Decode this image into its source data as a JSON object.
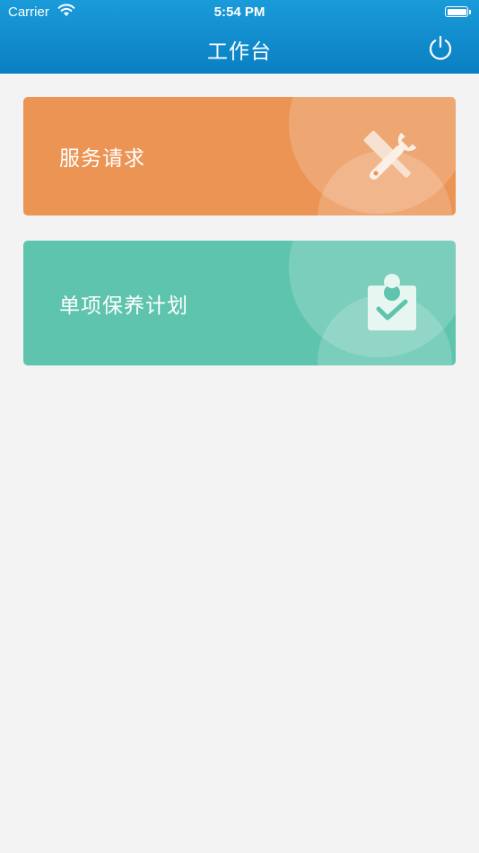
{
  "status_bar": {
    "carrier": "Carrier",
    "time": "5:54 PM"
  },
  "nav": {
    "title": "工作台",
    "power_icon": "power-icon"
  },
  "cards": [
    {
      "label": "服务请求",
      "icon": "tools-icon",
      "color": "#eb9454"
    },
    {
      "label": "单项保养计划",
      "icon": "clipboard-check-icon",
      "color": "#5ec4ad"
    }
  ],
  "colors": {
    "header": "#0a8fcf",
    "background": "#f3f3f3"
  }
}
